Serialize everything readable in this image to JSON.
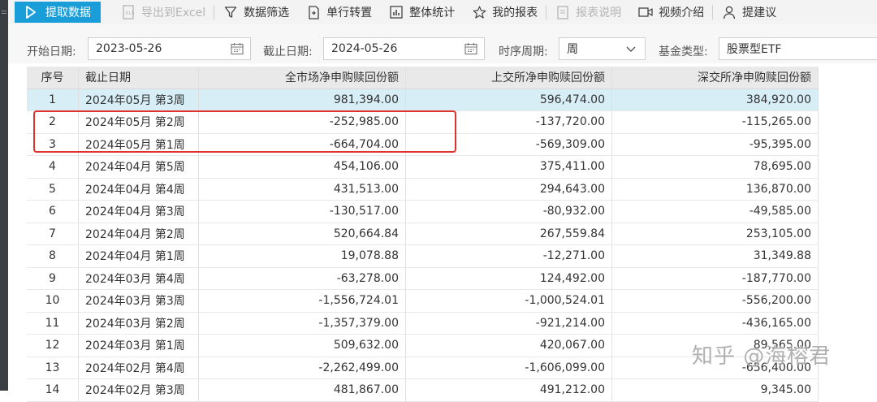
{
  "toolbar": {
    "buttons": [
      {
        "label": "提取数据",
        "icon": "play-icon"
      },
      {
        "label": "导出到Excel",
        "icon": "excel-icon"
      },
      {
        "label": "数据筛选",
        "icon": "filter-icon"
      },
      {
        "label": "单行转置",
        "icon": "transpose-icon"
      },
      {
        "label": "整体统计",
        "icon": "bar-chart-icon"
      },
      {
        "label": "我的报表",
        "icon": "star-icon"
      },
      {
        "label": "报表说明",
        "icon": "document-icon"
      },
      {
        "label": "视频介绍",
        "icon": "video-icon"
      },
      {
        "label": "提建议",
        "icon": "user-icon"
      }
    ]
  },
  "filters": {
    "start_label": "开始日期:",
    "start_value": "2023-05-26",
    "end_label": "截止日期:",
    "end_value": "2024-05-26",
    "period_label": "时序周期:",
    "period_value": "周",
    "fund_label": "基金类型:",
    "fund_value": "股票型ETF"
  },
  "table": {
    "headers": [
      "序号",
      "截止日期",
      "全市场净申购赎回份额",
      "上交所净申购赎回份额",
      "深交所净申购赎回份额"
    ],
    "rows": [
      [
        "1",
        "2024年05月 第3周",
        "981,394.00",
        "596,474.00",
        "384,920.00"
      ],
      [
        "2",
        "2024年05月 第2周",
        "-252,985.00",
        "-137,720.00",
        "-115,265.00"
      ],
      [
        "3",
        "2024年05月 第1周",
        "-664,704.00",
        "-569,309.00",
        "-95,395.00"
      ],
      [
        "4",
        "2024年04月 第5周",
        "454,106.00",
        "375,411.00",
        "78,695.00"
      ],
      [
        "5",
        "2024年04月 第4周",
        "431,513.00",
        "294,643.00",
        "136,870.00"
      ],
      [
        "6",
        "2024年04月 第3周",
        "-130,517.00",
        "-80,932.00",
        "-49,585.00"
      ],
      [
        "7",
        "2024年04月 第2周",
        "520,664.84",
        "267,559.84",
        "253,105.00"
      ],
      [
        "8",
        "2024年04月 第1周",
        "19,078.88",
        "-12,271.00",
        "31,349.88"
      ],
      [
        "9",
        "2024年03月 第4周",
        "-63,278.00",
        "124,492.00",
        "-187,770.00"
      ],
      [
        "10",
        "2024年03月 第3周",
        "-1,556,724.01",
        "-1,000,524.01",
        "-556,200.00"
      ],
      [
        "11",
        "2024年03月 第2周",
        "-1,357,379.00",
        "-921,214.00",
        "-436,165.00"
      ],
      [
        "12",
        "2024年03月 第1周",
        "509,632.00",
        "420,067.00",
        "89,565.00"
      ],
      [
        "13",
        "2024年02月 第4周",
        "-2,262,499.00",
        "-1,606,099.00",
        "-656,400.00"
      ],
      [
        "14",
        "2024年02月 第3周",
        "481,867.00",
        "491,212.00",
        "9,345.00"
      ]
    ]
  },
  "watermark": "知乎 @海榕君",
  "colors": {
    "primary": "#1a9ed9",
    "selected_row": "#d8eef6",
    "highlight": "#e0312e"
  }
}
